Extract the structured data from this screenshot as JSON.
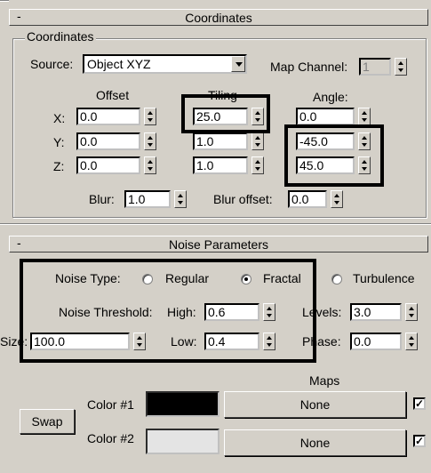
{
  "coordinates": {
    "rollout_title": "Coordinates",
    "group_label": "Coordinates",
    "source_label": "Source:",
    "source_value": "Object XYZ",
    "map_channel_label": "Map Channel:",
    "map_channel_value": "1",
    "offset_label": "Offset",
    "tiling_label": "Tiling",
    "angle_label": "Angle:",
    "x_label": "X:",
    "y_label": "Y:",
    "z_label": "Z:",
    "offset_x": "0.0",
    "offset_y": "0.0",
    "offset_z": "0.0",
    "tiling_x": "25.0",
    "tiling_y": "1.0",
    "tiling_z": "1.0",
    "angle_x": "0.0",
    "angle_y": "-45.0",
    "angle_z": "45.0",
    "blur_label": "Blur:",
    "blur_value": "1.0",
    "blur_offset_label": "Blur offset:",
    "blur_offset_value": "0.0"
  },
  "noise": {
    "rollout_title": "Noise Parameters",
    "noise_type_label": "Noise Type:",
    "regular_label": "Regular",
    "fractal_label": "Fractal",
    "turbulence_label": "Turbulence",
    "selected_type": "Fractal",
    "threshold_label": "Noise Threshold:",
    "high_label": "High:",
    "high_value": "0.6",
    "low_label": "Low:",
    "low_value": "0.4",
    "levels_label": "Levels:",
    "levels_value": "3.0",
    "size_label": "Size:",
    "size_value": "100.0",
    "phase_label": "Phase:",
    "phase_value": "0.0",
    "maps_label": "Maps",
    "swap_label": "Swap",
    "color1_label": "Color #1",
    "color2_label": "Color #2",
    "color1_hex": "#000000",
    "color2_hex": "#e4e4e4",
    "map1_label": "None",
    "map2_label": "None",
    "map1_checked": true,
    "map2_checked": true
  }
}
